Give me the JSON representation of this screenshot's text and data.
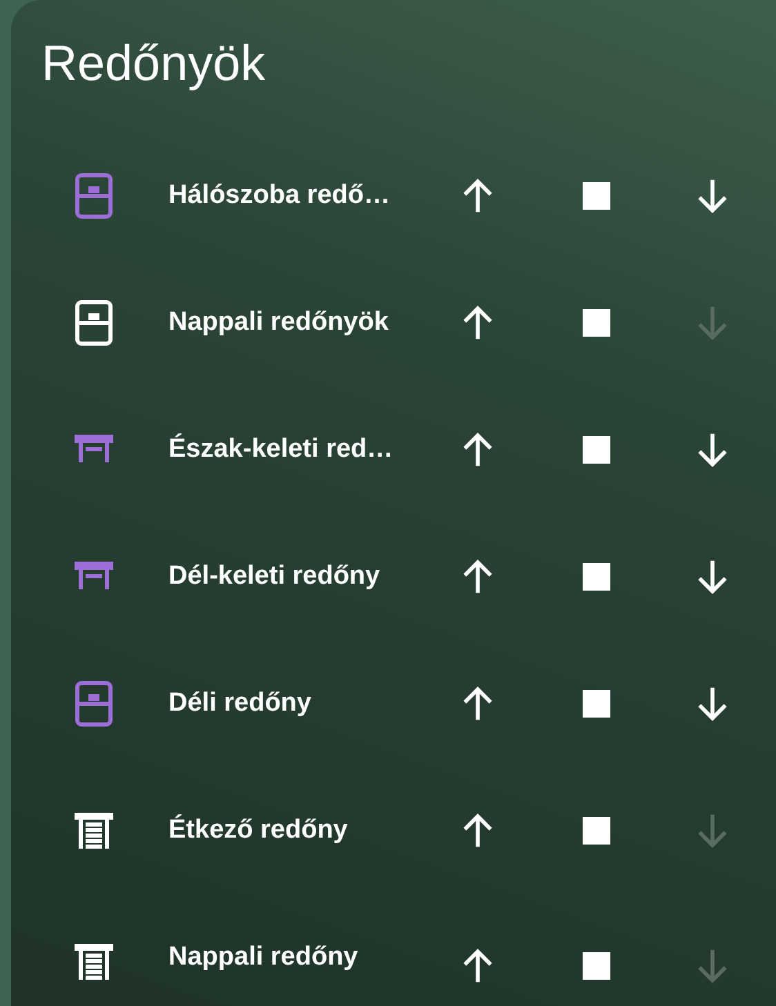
{
  "card": {
    "title": "Redőnyök"
  },
  "covers": [
    {
      "name": "Hálószoba redő…",
      "kind": "partial",
      "active": true,
      "down_disabled": false
    },
    {
      "name": "Nappali redőnyök",
      "kind": "partial",
      "active": false,
      "down_disabled": true
    },
    {
      "name": "Észak-keleti red…",
      "kind": "open",
      "active": true,
      "down_disabled": false
    },
    {
      "name": "Dél-keleti redőny",
      "kind": "open",
      "active": true,
      "down_disabled": false
    },
    {
      "name": "Déli redőny",
      "kind": "partial",
      "active": true,
      "down_disabled": false
    },
    {
      "name": "Étkező redőny",
      "kind": "closed",
      "active": false,
      "down_disabled": true
    },
    {
      "name": "Nappali redőny",
      "kind": "closed",
      "active": false,
      "down_disabled": true
    }
  ]
}
